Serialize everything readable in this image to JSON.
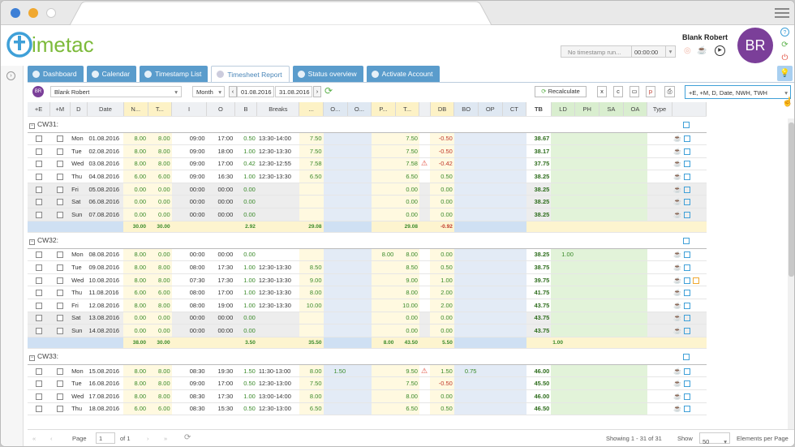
{
  "user": {
    "name": "Blank Robert",
    "initials": "BR"
  },
  "timer": {
    "placeholder": "No timestamp run...",
    "time": "00:00:00"
  },
  "tabs": [
    {
      "label": "Dashboard",
      "active": false
    },
    {
      "label": "Calendar",
      "active": false
    },
    {
      "label": "Timestamp List",
      "active": false
    },
    {
      "label": "Timesheet Report",
      "active": true
    },
    {
      "label": "Status overview",
      "active": false
    },
    {
      "label": "Activate Account",
      "active": false
    }
  ],
  "toolbar": {
    "user_select": "Blank Robert",
    "period": "Month",
    "from": "01.08.2016",
    "to": "31.08.2016",
    "recalculate": "Recalculate",
    "columns_select": "+E, +M, D, Date, NWH, TWH"
  },
  "columns": [
    "+E",
    "+M",
    "D",
    "Date",
    "N...",
    "T...",
    "I",
    "O",
    "B",
    "Breaks",
    "...",
    "O...",
    "O...",
    "P...",
    "T...",
    "",
    "DB",
    "BO",
    "OP",
    "CT",
    "TB",
    "LD",
    "PH",
    "SA",
    "OA",
    "Type",
    ""
  ],
  "groups": [
    {
      "label": "CW31:",
      "rows": [
        {
          "day": "Mon",
          "date": "01.08.2016",
          "n": "8.00",
          "t": "8.00",
          "i": "09:00",
          "o": "17:00",
          "b": "0.50",
          "br": "13:30-14:00",
          "x": "7.50",
          "p": "",
          "p2": "",
          "tt": "7.50",
          "warn": false,
          "db": "-0.50",
          "tb": "38.67",
          "ld": "",
          "we": false,
          "extra": false
        },
        {
          "day": "Tue",
          "date": "02.08.2016",
          "n": "8.00",
          "t": "8.00",
          "i": "09:00",
          "o": "18:00",
          "b": "1.00",
          "br": "12:30-13:30",
          "x": "7.50",
          "p": "",
          "p2": "",
          "tt": "7.50",
          "warn": false,
          "db": "-0.50",
          "tb": "38.17",
          "ld": "",
          "we": false,
          "extra": false
        },
        {
          "day": "Wed",
          "date": "03.08.2016",
          "n": "8.00",
          "t": "8.00",
          "i": "09:00",
          "o": "17:00",
          "b": "0.42",
          "br": "12:30-12:55",
          "x": "7.58",
          "p": "",
          "p2": "",
          "tt": "7.58",
          "warn": true,
          "db": "-0.42",
          "tb": "37.75",
          "ld": "",
          "we": false,
          "extra": false
        },
        {
          "day": "Thu",
          "date": "04.08.2016",
          "n": "6.00",
          "t": "6.00",
          "i": "09:00",
          "o": "16:30",
          "b": "1.00",
          "br": "12:30-13:30",
          "x": "6.50",
          "p": "",
          "p2": "",
          "tt": "6.50",
          "warn": false,
          "db": "0.50",
          "tb": "38.25",
          "ld": "",
          "we": false,
          "extra": false
        },
        {
          "day": "Fri",
          "date": "05.08.2016",
          "n": "0.00",
          "t": "0.00",
          "i": "00:00",
          "o": "00:00",
          "b": "0.00",
          "br": "",
          "x": "",
          "p": "",
          "p2": "",
          "tt": "0.00",
          "warn": false,
          "db": "0.00",
          "tb": "38.25",
          "ld": "",
          "we": true,
          "extra": false
        },
        {
          "day": "Sat",
          "date": "06.08.2016",
          "n": "0.00",
          "t": "0.00",
          "i": "00:00",
          "o": "00:00",
          "b": "0.00",
          "br": "",
          "x": "",
          "p": "",
          "p2": "",
          "tt": "0.00",
          "warn": false,
          "db": "0.00",
          "tb": "38.25",
          "ld": "",
          "we": true,
          "extra": false
        },
        {
          "day": "Sun",
          "date": "07.08.2016",
          "n": "0.00",
          "t": "0.00",
          "i": "00:00",
          "o": "00:00",
          "b": "0.00",
          "br": "",
          "x": "",
          "p": "",
          "p2": "",
          "tt": "0.00",
          "warn": false,
          "db": "0.00",
          "tb": "38.25",
          "ld": "",
          "we": true,
          "extra": false
        }
      ],
      "sum": {
        "n": "30.00",
        "t": "30.00",
        "b": "2.92",
        "x": "29.08",
        "p": "",
        "tt": "29.08",
        "db": "-0.92",
        "ld": ""
      }
    },
    {
      "label": "CW32:",
      "rows": [
        {
          "day": "Mon",
          "date": "08.08.2016",
          "n": "8.00",
          "t": "0.00",
          "i": "00:00",
          "o": "00:00",
          "b": "0.00",
          "br": "",
          "x": "",
          "p": "8.00",
          "p2": "",
          "tt": "8.00",
          "warn": false,
          "db": "0.00",
          "tb": "38.25",
          "ld": "1.00",
          "we": false,
          "extra": false
        },
        {
          "day": "Tue",
          "date": "09.08.2016",
          "n": "8.00",
          "t": "8.00",
          "i": "08:00",
          "o": "17:30",
          "b": "1.00",
          "br": "12:30-13:30",
          "x": "8.50",
          "p": "",
          "p2": "",
          "tt": "8.50",
          "warn": false,
          "db": "0.50",
          "tb": "38.75",
          "ld": "",
          "we": false,
          "extra": false
        },
        {
          "day": "Wed",
          "date": "10.08.2016",
          "n": "8.00",
          "t": "8.00",
          "i": "07:30",
          "o": "17:30",
          "b": "1.00",
          "br": "12:30-13:30",
          "x": "9.00",
          "p": "",
          "p2": "",
          "tt": "9.00",
          "warn": false,
          "db": "1.00",
          "tb": "39.75",
          "ld": "",
          "we": false,
          "extra": true
        },
        {
          "day": "Thu",
          "date": "11.08.2016",
          "n": "6.00",
          "t": "6.00",
          "i": "08:00",
          "o": "17:00",
          "b": "1.00",
          "br": "12:30-13:30",
          "x": "8.00",
          "p": "",
          "p2": "",
          "tt": "8.00",
          "warn": false,
          "db": "2.00",
          "tb": "41.75",
          "ld": "",
          "we": false,
          "extra": false
        },
        {
          "day": "Fri",
          "date": "12.08.2016",
          "n": "8.00",
          "t": "8.00",
          "i": "08:00",
          "o": "19:00",
          "b": "1.00",
          "br": "12:30-13:30",
          "x": "10.00",
          "p": "",
          "p2": "",
          "tt": "10.00",
          "warn": false,
          "db": "2.00",
          "tb": "43.75",
          "ld": "",
          "we": false,
          "extra": false
        },
        {
          "day": "Sat",
          "date": "13.08.2016",
          "n": "0.00",
          "t": "0.00",
          "i": "00:00",
          "o": "00:00",
          "b": "0.00",
          "br": "",
          "x": "",
          "p": "",
          "p2": "",
          "tt": "0.00",
          "warn": false,
          "db": "0.00",
          "tb": "43.75",
          "ld": "",
          "we": true,
          "extra": false
        },
        {
          "day": "Sun",
          "date": "14.08.2016",
          "n": "0.00",
          "t": "0.00",
          "i": "00:00",
          "o": "00:00",
          "b": "0.00",
          "br": "",
          "x": "",
          "p": "",
          "p2": "",
          "tt": "0.00",
          "warn": false,
          "db": "0.00",
          "tb": "43.75",
          "ld": "",
          "we": true,
          "extra": false
        }
      ],
      "sum": {
        "n": "38.00",
        "t": "30.00",
        "b": "3.50",
        "x": "35.50",
        "p": "8.00",
        "tt": "43.50",
        "db": "5.50",
        "ld": "1.00"
      }
    },
    {
      "label": "CW33:",
      "rows": [
        {
          "day": "Mon",
          "date": "15.08.2016",
          "n": "8.00",
          "t": "8.00",
          "i": "08:30",
          "o": "19:30",
          "b": "1.50",
          "br": "11:30-13:00",
          "x": "8.00",
          "p": "",
          "p2": "1.50",
          "tt": "9.50",
          "warn": true,
          "db": "1.50",
          "bo": "0.75",
          "tb": "46.00",
          "ld": "",
          "we": false,
          "extra": false
        },
        {
          "day": "Tue",
          "date": "16.08.2016",
          "n": "8.00",
          "t": "8.00",
          "i": "09:00",
          "o": "17:00",
          "b": "0.50",
          "br": "12:30-13:00",
          "x": "7.50",
          "p": "",
          "p2": "",
          "tt": "7.50",
          "warn": false,
          "db": "-0.50",
          "tb": "45.50",
          "ld": "",
          "we": false,
          "extra": false
        },
        {
          "day": "Wed",
          "date": "17.08.2016",
          "n": "8.00",
          "t": "8.00",
          "i": "08:30",
          "o": "17:30",
          "b": "1.00",
          "br": "13:00-14:00",
          "x": "8.00",
          "p": "",
          "p2": "",
          "tt": "8.00",
          "warn": false,
          "db": "0.00",
          "tb": "46.00",
          "ld": "",
          "we": false,
          "extra": false
        },
        {
          "day": "Thu",
          "date": "18.08.2016",
          "n": "6.00",
          "t": "6.00",
          "i": "08:30",
          "o": "15:30",
          "b": "0.50",
          "br": "12:30-13:00",
          "x": "6.50",
          "p": "",
          "p2": "",
          "tt": "6.50",
          "warn": false,
          "db": "0.50",
          "tb": "46.50",
          "ld": "",
          "we": false,
          "extra": false
        }
      ]
    }
  ],
  "footer": {
    "page_label": "Page",
    "page": "1",
    "of": "of 1",
    "showing": "Showing 1 - 31 of 31",
    "show_label": "Show",
    "per_page": "50",
    "elements_label": "Elements per Page"
  }
}
